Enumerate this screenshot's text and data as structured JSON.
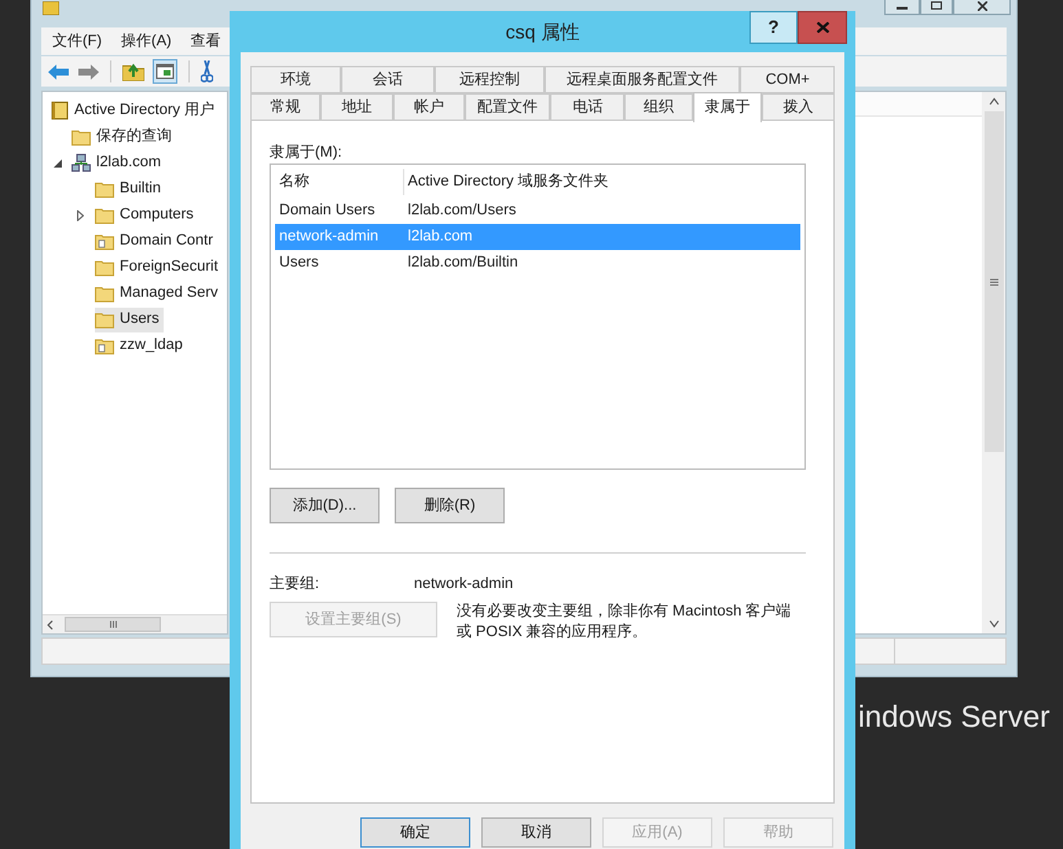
{
  "desktop_text": "indows Server",
  "main_window": {
    "menu": [
      "文件(F)",
      "操作(A)",
      "查看"
    ],
    "tree": [
      {
        "label": "Active Directory 用户",
        "kind": "root",
        "selected": false,
        "children": [
          {
            "label": "保存的查询",
            "kind": "folder",
            "selected": false
          },
          {
            "label": "l2lab.com",
            "kind": "domain",
            "selected": false,
            "expanded": true,
            "children": [
              {
                "label": "Builtin",
                "kind": "folder",
                "selected": false
              },
              {
                "label": "Computers",
                "kind": "folder",
                "selected": false,
                "expanded": false
              },
              {
                "label": "Domain Contr",
                "kind": "ou",
                "selected": false
              },
              {
                "label": "ForeignSecurit",
                "kind": "folder",
                "selected": false
              },
              {
                "label": "Managed Serv",
                "kind": "folder",
                "selected": false
              },
              {
                "label": "Users",
                "kind": "folder",
                "selected": true
              },
              {
                "label": "zzw_ldap",
                "kind": "ou",
                "selected": false
              }
            ]
          }
        ]
      }
    ]
  },
  "dialog": {
    "title": "csq 属性",
    "help": "?",
    "tab_rows": [
      {
        "tabs": [
          {
            "label": "环境",
            "selected": false
          },
          {
            "label": "会话",
            "selected": false
          },
          {
            "label": "远程控制",
            "selected": false
          },
          {
            "label": "远程桌面服务配置文件",
            "selected": false
          },
          {
            "label": "COM+",
            "selected": false
          }
        ]
      },
      {
        "tabs": [
          {
            "label": "常规",
            "selected": false
          },
          {
            "label": "地址",
            "selected": false
          },
          {
            "label": "帐户",
            "selected": false
          },
          {
            "label": "配置文件",
            "selected": false
          },
          {
            "label": "电话",
            "selected": false
          },
          {
            "label": "组织",
            "selected": false
          },
          {
            "label": "隶属于",
            "selected": true
          },
          {
            "label": "拨入",
            "selected": false
          }
        ]
      }
    ],
    "member_of": {
      "label": "隶属于(M):",
      "columns": [
        "名称",
        "Active Directory 域服务文件夹"
      ],
      "rows": [
        {
          "cells": [
            "Domain Users",
            "l2lab.com/Users"
          ],
          "selected": false
        },
        {
          "cells": [
            "network-admin",
            "l2lab.com"
          ],
          "selected": true
        },
        {
          "cells": [
            "Users",
            "l2lab.com/Builtin"
          ],
          "selected": false
        }
      ]
    },
    "list_buttons": [
      {
        "label": "添加(D)..."
      },
      {
        "label": "删除(R)"
      }
    ],
    "primary_group": {
      "label": "主要组:",
      "value": "network-admin",
      "button": {
        "label": "设置主要组(S)",
        "disabled": true
      },
      "note": "没有必要改变主要组，除非你有 Macintosh 客户端或 POSIX 兼容的应用程序。"
    },
    "footer_buttons": [
      {
        "label": "确定",
        "disabled": false,
        "default": true
      },
      {
        "label": "取消",
        "disabled": false,
        "default": false
      },
      {
        "label": "应用(A)",
        "disabled": true,
        "default": false
      },
      {
        "label": "帮助",
        "disabled": true,
        "default": false
      }
    ]
  }
}
